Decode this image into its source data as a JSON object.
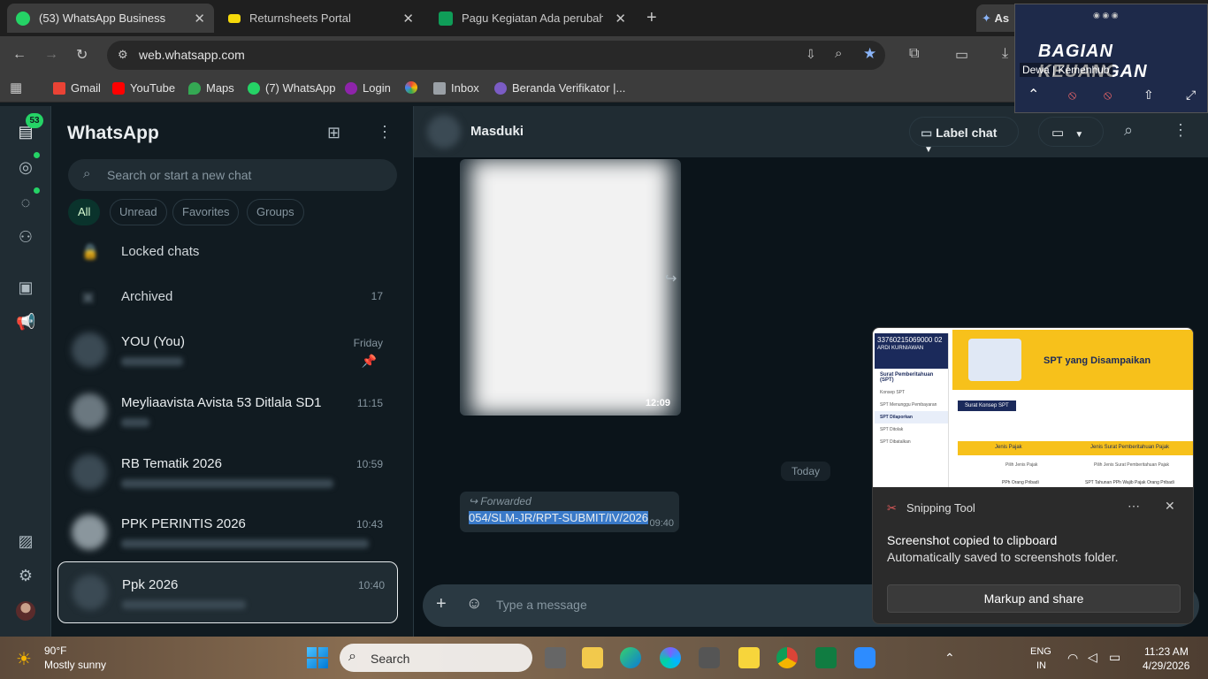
{
  "browser": {
    "tabs": [
      {
        "title": "(53) WhatsApp Business",
        "active": true,
        "icon": "whatsapp-icon"
      },
      {
        "title": "Returnsheets Portal",
        "active": false,
        "icon": "portal-icon"
      },
      {
        "title": "Pagu Kegiatan Ada perubahan",
        "active": false,
        "icon": "sheets-icon"
      }
    ],
    "extra_tab": "As",
    "url": "web.whatsapp.com",
    "bookmarks": [
      "Gmail",
      "YouTube",
      "Maps",
      "(7) WhatsApp",
      "Login",
      "Inbox",
      "Beranda Verifikator |..."
    ]
  },
  "video_call": {
    "banner": "BAGIAN KEUANGAN",
    "participant": "Dewa | Kemenhub"
  },
  "whatsapp": {
    "badge_count": "53",
    "title": "WhatsApp",
    "search_placeholder": "Search or start a new chat",
    "filters": [
      "All",
      "Unread",
      "Favorites",
      "Groups"
    ],
    "special_rows": {
      "locked": "Locked chats",
      "archived": "Archived",
      "archived_count": "17"
    },
    "chats": [
      {
        "name": "YOU (You)",
        "time": "Friday",
        "pinned": true
      },
      {
        "name": "Meyliaavista Avista 53 Ditlala SD1",
        "time": "11:15"
      },
      {
        "name": "RB Tematik 2026",
        "time": "10:59"
      },
      {
        "name": "PPK PERINTIS 2026",
        "time": "10:43"
      },
      {
        "name": "Ppk 2026",
        "time": "10:40",
        "selected": true
      }
    ],
    "conversation": {
      "contact": "Masduki",
      "label_chat": "Label chat",
      "image_time": "12:09",
      "date_divider": "Today",
      "forwarded_label": "Forwarded",
      "message_text": "054/SLM-JR/RPT-SUBMIT/IV/2026",
      "message_time": "09:40",
      "composer_placeholder": "Type a message"
    }
  },
  "snipping_tool": {
    "app_name": "Snipping Tool",
    "title": "Screenshot copied to clipboard",
    "subtitle": "Automatically saved to screenshots folder.",
    "button": "Markup and share",
    "preview": {
      "id_number": "33760215069000 02",
      "person": "ARDI KURNIAWAN",
      "menu_title": "Surat Pemberitahuan (SPT)",
      "menu_items": [
        "Konsep SPT",
        "SPT Menunggu Pembayaran",
        "SPT Dilaporkan",
        "SPT Ditolak",
        "SPT Dibatalkan"
      ],
      "banner": "SPT yang Disampaikan",
      "button": "Surat Konsep SPT",
      "col1": "Jenis Pajak",
      "col2": "Jenis Surat Pemberitahuan Pajak",
      "select1": "Pilih Jenis Pajak",
      "select2": "Pilih Jenis Surat Pemberitahuan Pajak",
      "row1a": "PPh Orang Pribadi",
      "row1b": "SPT Tahunan PPh Wajib Pajak Orang Pribadi"
    }
  },
  "taskbar": {
    "weather_temp": "90°F",
    "weather_desc": "Mostly sunny",
    "search": "Search",
    "lang1": "ENG",
    "lang2": "IN",
    "time": "11:23 AM",
    "date": "4/29/2026"
  }
}
